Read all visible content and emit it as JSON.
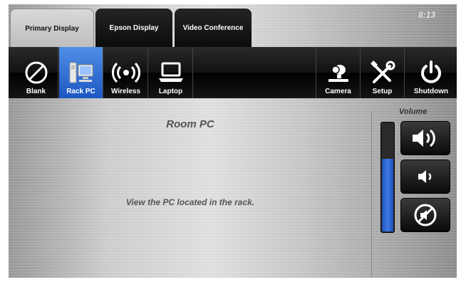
{
  "clock": "8:13",
  "tabs": [
    {
      "label": "Primary Display",
      "active": true
    },
    {
      "label": "Epson Display",
      "active": false
    },
    {
      "label": "Video Conference",
      "active": false
    }
  ],
  "sources": [
    {
      "label": "Blank",
      "icon": "blank-icon",
      "active": false
    },
    {
      "label": "Rack PC",
      "icon": "pc-icon",
      "active": true
    },
    {
      "label": "Wireless",
      "icon": "wireless-icon",
      "active": false
    },
    {
      "label": "Laptop",
      "icon": "laptop-icon",
      "active": false
    }
  ],
  "actions": [
    {
      "label": "Camera",
      "icon": "camera-icon"
    },
    {
      "label": "Setup",
      "icon": "tools-icon"
    },
    {
      "label": "Shutdown",
      "icon": "power-icon"
    }
  ],
  "content": {
    "title": "Room PC",
    "message": "View the PC located in the rack."
  },
  "volume": {
    "label": "Volume",
    "level": 0.66,
    "buttons": [
      "volume-up",
      "volume-down",
      "mute"
    ]
  },
  "colors": {
    "active_source": "#2f6fd6",
    "meter_fill": "#3a72df"
  }
}
